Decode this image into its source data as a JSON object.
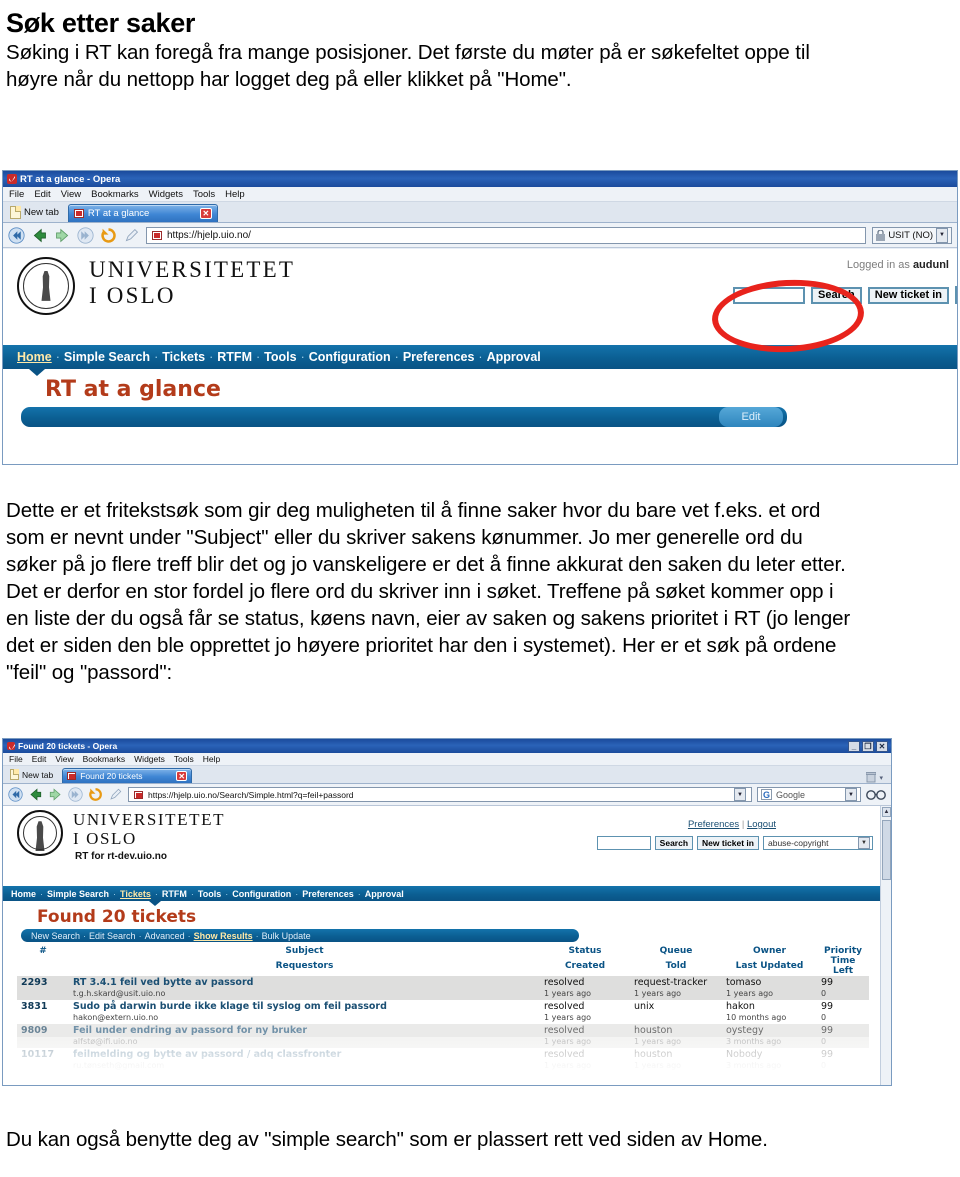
{
  "document": {
    "title": "Søk etter saker",
    "intro": "Søking i RT kan foregå fra mange posisjoner. Det første du møter på er søkefeltet oppe til høyre når du nettopp har logget deg på eller klikket på \"Home\".",
    "body": "Dette er et fritekstsøk som gir deg muligheten til å finne saker hvor du bare vet f.eks. et ord som er nevnt under \"Subject\" eller du skriver sakens kønummer. Jo mer generelle ord du søker på jo flere treff blir det og jo vanskeligere er det å finne akkurat den saken du leter etter. Det er derfor en stor fordel jo flere ord du skriver inn i søket. Treffene på søket kommer opp i en liste der du også får se status, køens navn, eier av saken og sakens prioritet i RT (jo lenger det er siden den ble opprettet jo høyere prioritet har den i systemet). Her er et søk på ordene \"feil\" og \"passord\":",
    "footer": "Du kan også benytte deg av \"simple search\" som er plassert rett ved siden av Home."
  },
  "browser1": {
    "window_title": "RT at a glance - Opera",
    "menus": [
      "File",
      "Edit",
      "View",
      "Bookmarks",
      "Widgets",
      "Tools",
      "Help"
    ],
    "new_tab_label": "New tab",
    "tab_label": "RT at a glance",
    "tab_close": "✕",
    "address": "https://hjelp.uio.no/",
    "zone_label": "USIT (NO)"
  },
  "rt1": {
    "org_line1": "UNIVERSITETET",
    "org_line2": "I OSLO",
    "logged_in_prefix": "Logged in as ",
    "logged_in_user": "audunl",
    "search_value": "",
    "search_button": "Search",
    "new_ticket_button": "New ticket in",
    "nav": [
      "Home",
      "Simple Search",
      "Tickets",
      "RTFM",
      "Tools",
      "Configuration",
      "Preferences",
      "Approval"
    ],
    "nav_current": "Home",
    "page_title": "RT at a glance",
    "edit_label": "Edit"
  },
  "browser2": {
    "window_title": "Found 20 tickets - Opera",
    "menus": [
      "File",
      "Edit",
      "View",
      "Bookmarks",
      "Widgets",
      "Tools",
      "Help"
    ],
    "new_tab_label": "New tab",
    "tab_label": "Found 20 tickets",
    "tab_close": "✕",
    "address": "https://hjelp.uio.no/Search/Simple.html?q=feil+passord",
    "search_engine": "Google",
    "win_min": "_",
    "win_max": "❐",
    "win_close": "✕"
  },
  "rt2": {
    "org_line1": "UNIVERSITETET",
    "org_line2": "I OSLO",
    "subtitle": "RT for rt-dev.uio.no",
    "prefs_link": "Preferences",
    "logout_link": "Logout",
    "link_divider": "|",
    "search_value": "",
    "search_button": "Search",
    "new_ticket_button": "New ticket in",
    "queue_select": "abuse-copyright",
    "nav": [
      "Home",
      "Simple Search",
      "Tickets",
      "RTFM",
      "Tools",
      "Configuration",
      "Preferences",
      "Approval"
    ],
    "nav_current": "Tickets",
    "page_title": "Found 20 tickets",
    "subnav": [
      "New Search",
      "Edit Search",
      "Advanced",
      "Show Results",
      "Bulk Update"
    ],
    "subnav_current": "Show Results",
    "table": {
      "headers_row1": [
        "#",
        "Subject",
        "Status",
        "Queue",
        "Owner",
        "Priority"
      ],
      "headers_row2": [
        "",
        "Requestors",
        "Created",
        "Told",
        "Last Updated",
        "Time Left"
      ],
      "rows": [
        {
          "id": "2293",
          "subject": "RT 3.4.1 feil ved bytte av passord",
          "requestor": "t.g.h.skard@usit.uio.no",
          "status": "resolved",
          "created": "1 years ago",
          "queue": "request-tracker",
          "told": "1 years ago",
          "owner": "tomaso",
          "last_updated": "1 years ago",
          "priority": "99",
          "time_left": "0"
        },
        {
          "id": "3831",
          "subject": "Sudo på darwin burde ikke klage til syslog om feil passord",
          "requestor": "hakon@extern.uio.no",
          "status": "resolved",
          "created": "1 years ago",
          "queue": "unix",
          "told": "",
          "owner": "hakon",
          "last_updated": "10 months ago",
          "priority": "99",
          "time_left": "0"
        },
        {
          "id": "9809",
          "subject": "Feil under endring av passord for ny bruker",
          "requestor": "alfstø@ifi.uio.no",
          "status": "resolved",
          "created": "1 years ago",
          "queue": "houston",
          "told": "1 years ago",
          "owner": "oystegy",
          "last_updated": "3 months ago",
          "priority": "99",
          "time_left": "0"
        },
        {
          "id": "10117",
          "subject": "feilmelding og bytte av passord / adq classfronter",
          "requestor": "ru.tønseth@gmail.com",
          "status": "resolved",
          "created": "1 years ago",
          "queue": "houston",
          "told": "1 years ago",
          "owner": "Nobody",
          "last_updated": "3 months ago",
          "priority": "99",
          "time_left": "0"
        }
      ]
    }
  },
  "colors": {
    "rt_blue": "#0b5f93",
    "rt_title_red": "#b33b1a",
    "annotation_red": "#e8231c",
    "opera_titlebar": "#1b4b9c"
  }
}
